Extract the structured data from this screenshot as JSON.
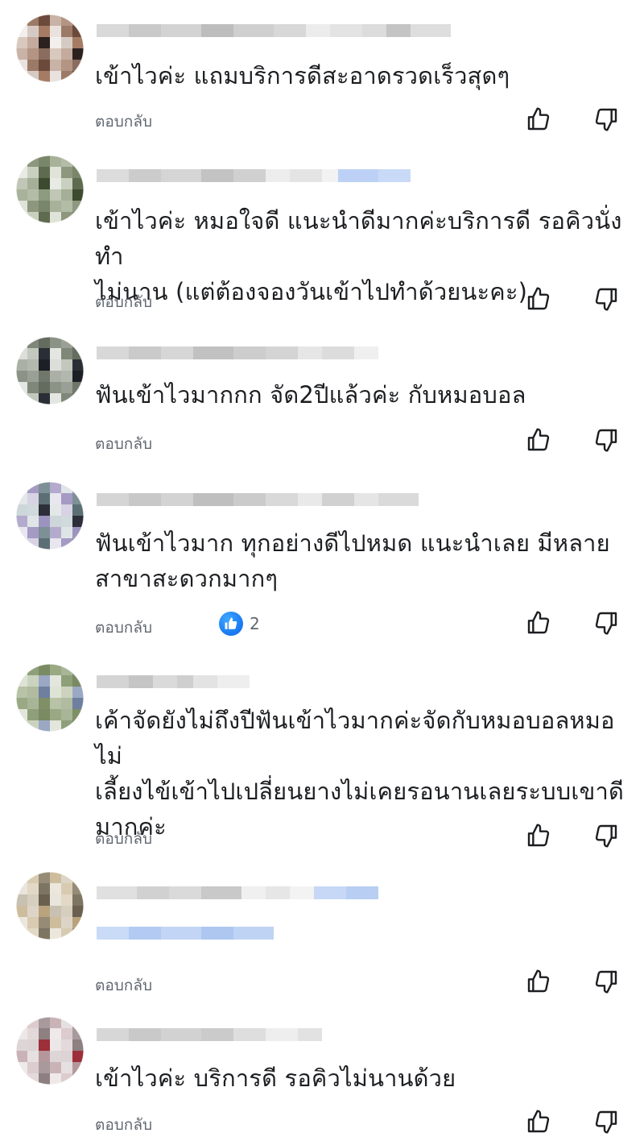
{
  "labels": {
    "reply": "ตอบกลับ"
  },
  "colors": {
    "like_blue": "#1877f2",
    "secondary_text": "#606770"
  },
  "icons": {
    "like": "thumbs-up-icon",
    "dislike": "thumbs-down-icon",
    "reaction": "like-reaction-icon"
  },
  "comments": [
    {
      "text": "เข้าไวค่ะ  แถมบริการดีสะอาดรวดเร็วสุดๆ"
    },
    {
      "text": "เข้าไวค่ะ หมอใจดี แนะนำดีมากค่ะบริการดี รอคิวนั่งทำ\nไม่นาน (แต่ต้องจองวันเข้าไปทำด้วยนะคะ)"
    },
    {
      "text": "ฟันเข้าไวมากกก จัด2ปีแล้วค่ะ กับหมอบอล"
    },
    {
      "text": "ฟันเข้าไวมาก ทุกอย่างดีไปหมด แนะนำเลย มีหลาย\nสาขาสะดวกมากๆ",
      "reaction_count": "2"
    },
    {
      "text": "เค้าจัดยังไม่ถึงปีฟันเข้าไวมากค่ะจัดกับหมอบอลหมอไม่\nเลี้ยงไข้เข้าไปเปลี่ยนยางไม่เคยรอนานเลยระบบเขาดี\nมากค่ะ"
    },
    {
      "text": ""
    },
    {
      "text": "เข้าไวค่ะ บริการดี รอคิวไม่นานด้วย"
    }
  ]
}
